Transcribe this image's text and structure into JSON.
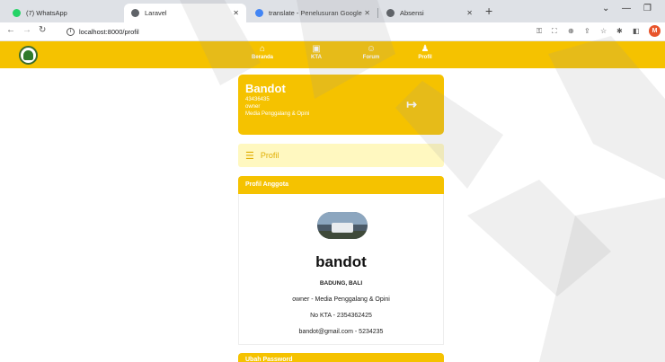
{
  "browser": {
    "tabs": [
      {
        "title": "(7) WhatsApp",
        "favicon_color": "#25d366"
      },
      {
        "title": "Laravel",
        "favicon_color": "#5f6368"
      },
      {
        "title": "translate - Penelusuran Google",
        "favicon_color": "#4285f4"
      },
      {
        "title": "Absensi",
        "favicon_color": "#5f6368"
      }
    ],
    "url": "localhost:8000/profil",
    "profile_initial": "M"
  },
  "nav": {
    "items": [
      {
        "label": "Beranda",
        "icon": "home-icon"
      },
      {
        "label": "KTA",
        "icon": "id-card-icon"
      },
      {
        "label": "Forum",
        "icon": "forum-icon"
      },
      {
        "label": "Profil",
        "icon": "user-icon"
      }
    ]
  },
  "profile_card": {
    "name": "Bandot",
    "id": "43436435",
    "role": "owner",
    "org": "Media Penggalang & Opini"
  },
  "section": {
    "title": "Profil"
  },
  "anggota": {
    "header": "Profil Anggota",
    "username": "bandot",
    "location": "BADUNG, BALI",
    "role_org": "owner - Media Penggalang & Opini",
    "kta": "No KTA - 2354362425",
    "contact": "bandot@gmail.com - 5234235"
  },
  "next_section": {
    "header": "Ubah Password"
  },
  "colors": {
    "brand": "#f5c200",
    "section_bg": "#fff8c0"
  }
}
